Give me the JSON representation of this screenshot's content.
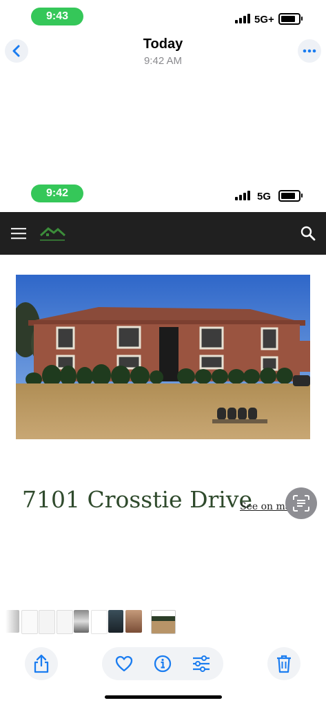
{
  "status_top": {
    "time": "9:43",
    "network": "5G+"
  },
  "header": {
    "title": "Today",
    "subtitle": "9:42 AM"
  },
  "status_embedded": {
    "time": "9:42",
    "network": "5G"
  },
  "listing": {
    "title": "7101 Crosstie Drive",
    "map_link": "See on map"
  },
  "icons": {
    "back": "chevron-left-icon",
    "more": "ellipsis-icon",
    "menu": "hamburger-menu-icon",
    "logo": "house-logo-icon",
    "search": "search-icon",
    "live_text": "live-text-icon",
    "share": "share-icon",
    "favorite": "heart-icon",
    "info": "info-icon",
    "adjust": "sliders-icon",
    "delete": "trash-icon"
  },
  "colors": {
    "accent": "#1a7cf0",
    "status_green": "#35c759",
    "site_bar": "#202020",
    "title_green": "#2f4a2c"
  }
}
